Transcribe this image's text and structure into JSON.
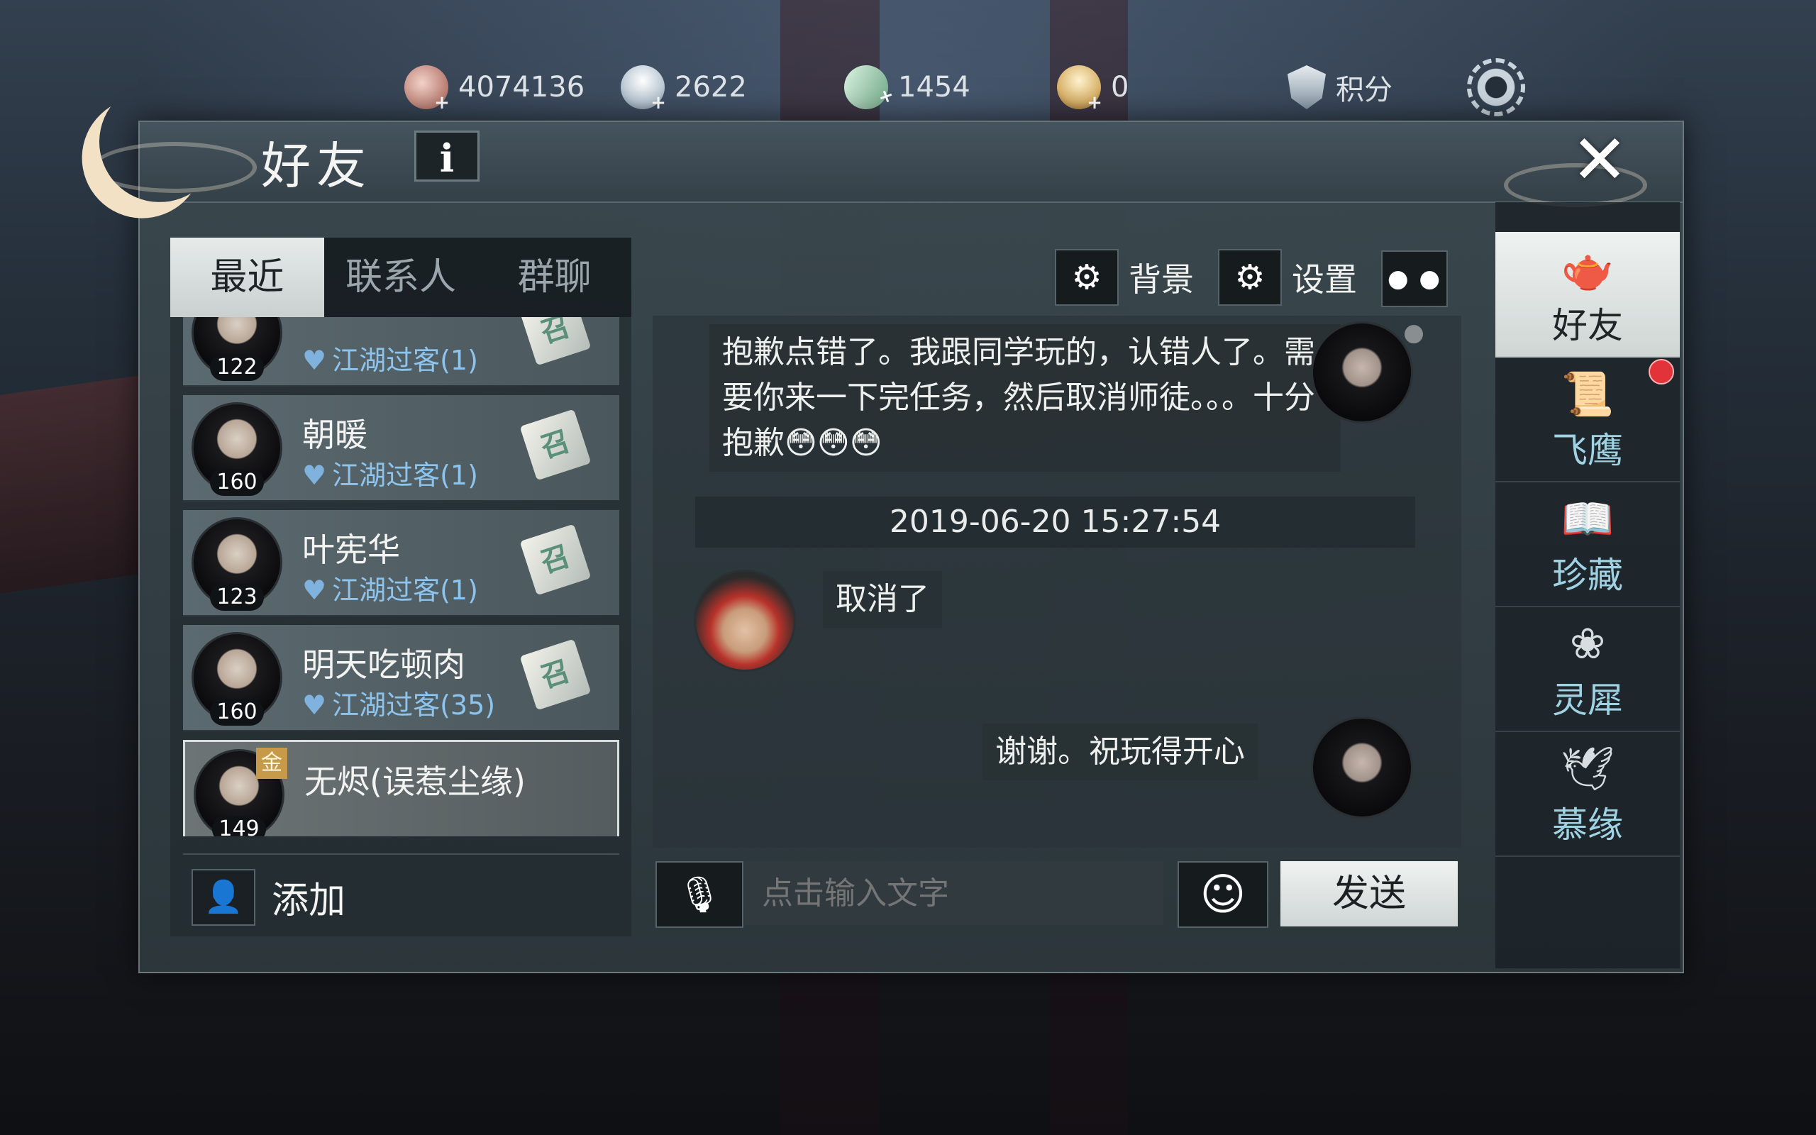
{
  "resources": {
    "copper": "4074136",
    "silver": "2622",
    "jade": "1454",
    "gold": "0",
    "points_label": "积分"
  },
  "panel": {
    "title": "好友",
    "info_label": "i",
    "close_label": "✕"
  },
  "left": {
    "tabs": [
      {
        "label": "最近"
      },
      {
        "label": "联系人"
      },
      {
        "label": "群聊"
      }
    ],
    "contacts": [
      {
        "name": "",
        "relation": "江湖过客(1)",
        "level": "122"
      },
      {
        "name": "朝暖",
        "relation": "江湖过客(1)",
        "level": "160"
      },
      {
        "name": "叶宪华",
        "relation": "江湖过客(1)",
        "level": "123"
      },
      {
        "name": "明天吃顿肉",
        "relation": "江湖过客(35)",
        "level": "160"
      },
      {
        "name": "无烬(误惹尘缘)",
        "relation": "",
        "level": "149",
        "badge": "金"
      }
    ],
    "add_label": "添加"
  },
  "chat": {
    "toolbar": {
      "background_label": "背景",
      "settings_label": "设置"
    },
    "messages": [
      {
        "text": "抱歉点错了。我跟同学玩的，认错人了。需要你来一下完任务，然后取消师徒。。。十分抱歉😳😳😳"
      },
      {
        "timestamp": "2019-06-20 15:27:54"
      },
      {
        "text": "取消了"
      },
      {
        "text": "谢谢。祝玩得开心"
      }
    ],
    "input_placeholder": "点击输入文字",
    "send_label": "发送"
  },
  "nav": {
    "items": [
      {
        "label": "好友",
        "icon": "teapot-icon"
      },
      {
        "label": "飞鹰",
        "icon": "scroll-icon"
      },
      {
        "label": "珍藏",
        "icon": "book-icon"
      },
      {
        "label": "灵犀",
        "icon": "ornament-icon"
      },
      {
        "label": "慕缘",
        "icon": "crane-icon"
      }
    ]
  },
  "colors": {
    "accent_blue": "#8cc4ee",
    "nav_label": "#9fd2e3",
    "notify_red": "#e2333a"
  }
}
